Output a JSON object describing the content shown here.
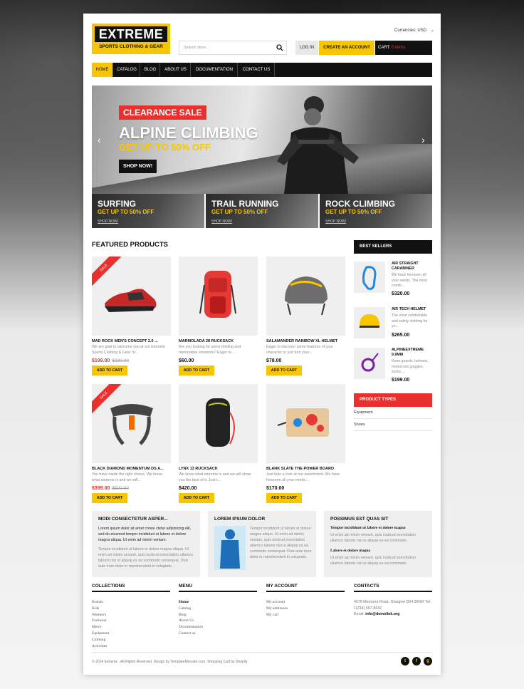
{
  "brand": {
    "name": "EXTREME",
    "tagline": "SPORTS CLOTHING & GEAR"
  },
  "currency": {
    "label": "Currencies:",
    "value": "USD"
  },
  "search": {
    "placeholder": "Search store..."
  },
  "header_buttons": {
    "login": "LOG IN",
    "create_account": "CREATE AN ACCOUNT",
    "cart_label": "CART:",
    "cart_value": "0 items"
  },
  "nav": [
    "HOME",
    "CATALOG",
    "BLOG",
    "ABOUT US",
    "DOCUMENTATION",
    "CONTACT US"
  ],
  "hero": {
    "badge": "CLEARANCE SALE",
    "title": "ALPINE CLIMBING",
    "subtitle": "GET UP TO 50% OFF",
    "button": "SHOP NOW!"
  },
  "sub_banners": [
    {
      "title": "SURFING",
      "subtitle": "GET UP TO 50% OFF",
      "link": "SHOP NOW!"
    },
    {
      "title": "TRAIL RUNNING",
      "subtitle": "GET UP TO 50% OFF",
      "link": "SHOP NOW!"
    },
    {
      "title": "ROCK CLIMBING",
      "subtitle": "GET UP TO 50% OFF",
      "link": "SHOP NOW!"
    }
  ],
  "featured": {
    "title": "FEATURED PRODUCTS",
    "add_to_cart": "ADD TO CART",
    "sale": "SALE",
    "products": [
      {
        "name": "MAD ROCK MEN'S CONCEPT 2.0 ...",
        "desc": "We are glad to welcome you at our Extreme Sports Clothing & Gear St...",
        "price": "$199.00",
        "old_price": "$230.00"
      },
      {
        "name": "MARMOLADA 28 RUCKSACK",
        "desc": "Are you looking for some thrilling and memorable emotions? Eager to...",
        "price": "$60.00",
        "old_price": ""
      },
      {
        "name": "SALAMANDER RAINBOW XL HELMET",
        "desc": "Eager to discover some features of your character or just turn your...",
        "price": "$78.00",
        "old_price": ""
      },
      {
        "name": "BLACK DIAMOND MOMENTUM DS A...",
        "desc": "You have made the right choice. We know what extreme is and we will...",
        "price": "$399.00",
        "old_price": "$500.00"
      },
      {
        "name": "LYNX 13 RUCKSACK",
        "desc": "We know what extreme is and we will show you the best of it. Just t...",
        "price": "$420.00",
        "old_price": ""
      },
      {
        "name": "BLANK SLATE THE POWER BOARD",
        "desc": "Just take a look at our assortment. We have foreseen all your needs ...",
        "price": "$170.00",
        "old_price": ""
      }
    ]
  },
  "best_sellers": {
    "title": "BEST SELLERS",
    "items": [
      {
        "name": "AIR STRAIGHT CARABINER",
        "desc": "We have foreseen all your needs. The most comfo...",
        "price": "$320.00"
      },
      {
        "name": "AIR TECH HELMET",
        "desc": "The most comfortable and safety clothing for yo...",
        "price": "$265.00"
      },
      {
        "name": "ALPINEEXTREME 9.9MM",
        "desc": "Knee guards, helmets, motocross goggles, socks ...",
        "price": "$199.00"
      }
    ]
  },
  "product_types": {
    "title": "PRODUCT TYPES",
    "items": [
      "Equipment",
      "Shoes"
    ]
  },
  "info_boxes": [
    {
      "title": "MODI CONSECTETUR ASPER...",
      "dark": "Lorem ipsum dolor sit amet conse ctetur adipisicing elit, sed do eiusmod tempor incididunt ut labore et dolore magna aliqua. Ut enim ad minim veniam.",
      "grey": "Tempor incididunt ut labore et dolore magna aliqua. Ut enim ad minim veniam, quis nostrud exercitation ullamco laboris nisi ut aliquip ex ea commodo consequat. Duis aute irure dolor in reprehenderit in voluptate."
    },
    {
      "title": "LOREM IPSUM DOLOR",
      "grey": "Tempor incididunt ut labore et dolore magna aliqua. Ut enim ad minim veniam, quis nostrud exercitation ullamco laboris nisi ut aliquip ex ea commodo consequat. Duis aute irure dolor in reprehenderit in voluptate."
    },
    {
      "title": "POSSIMUS EST QUAS SIT",
      "h1": "Tempor incididunt ut labore et dolore magna",
      "p1": "Ut enim ad minim veniam, quis nostrud exercitation ullamco laboris nisi ut aliquip ex ea commodo.",
      "h2": "Labore et dolore magna",
      "p2": "Ut enim ad minim veniam, quis nostrud exercitation ullamco laboris nisi ut aliquip ex ea commodo."
    }
  ],
  "footer": {
    "collections": {
      "title": "COLLECTIONS",
      "items": [
        "Brands",
        "Kids",
        "Women's",
        "Footwear",
        "Men's",
        "Equipment",
        "Clothing",
        "Activities"
      ]
    },
    "menu": {
      "title": "MENU",
      "items": [
        "Home",
        "Catalog",
        "Blog",
        "About Us",
        "Documentation",
        "Contact us"
      ]
    },
    "account": {
      "title": "MY ACCOUNT",
      "items": [
        "My account",
        "My addresses",
        "My cart"
      ]
    },
    "contacts": {
      "title": "CONTACTS",
      "address": "4578 Marmora Road, Glasgow D04 89GR Tel:",
      "phone": "1(234) 567-8642",
      "email_label": "Email:",
      "email": "info@demolink.org"
    },
    "copyright": "© 2014 Extreme . All Rights Reserved. Design by TemplateMonster.com. Shopping Cart by Shopify"
  },
  "colors": {
    "accent": "#f7c600",
    "dark": "#111111",
    "sale": "#e8302e"
  }
}
